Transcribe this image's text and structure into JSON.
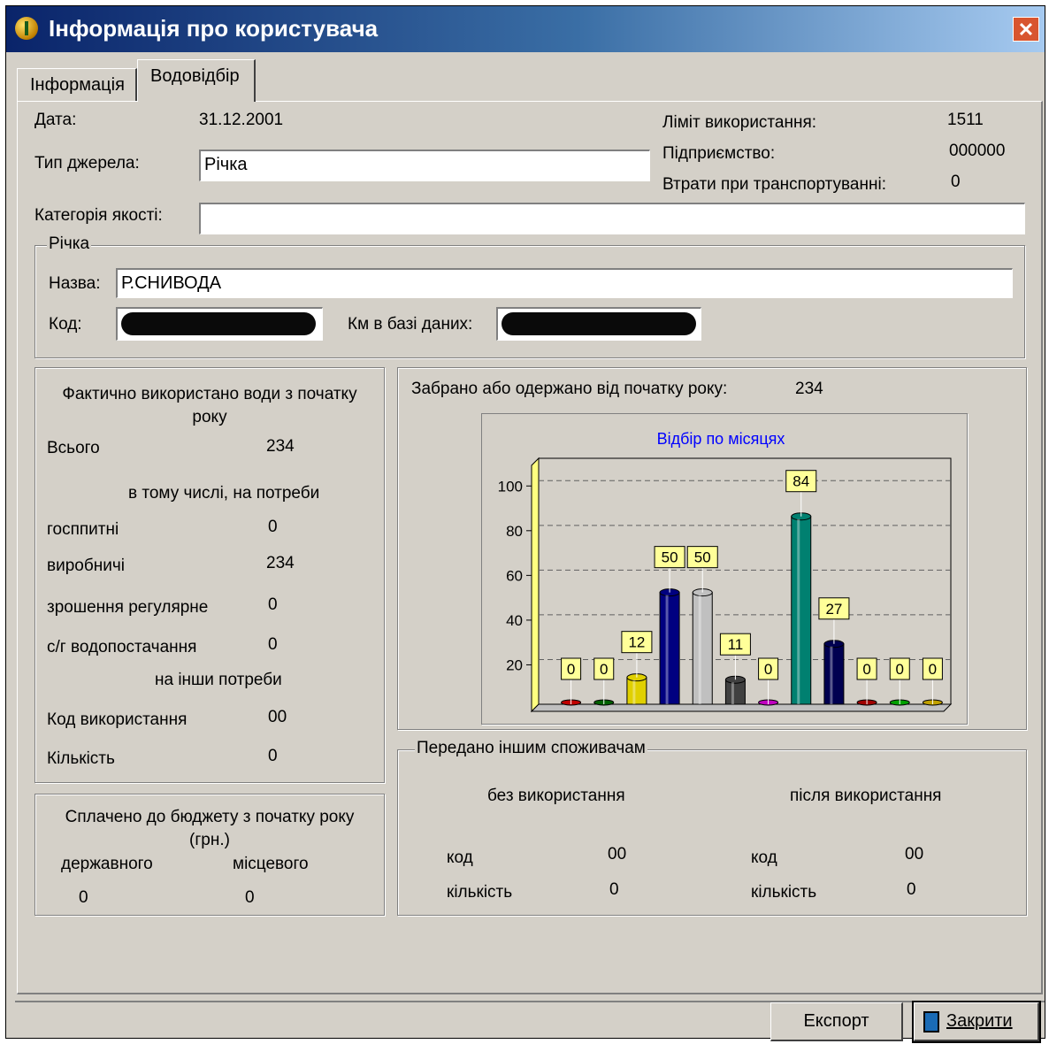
{
  "window": {
    "title": "Інформація про користувача"
  },
  "tabs": [
    {
      "label": "Інформація"
    },
    {
      "label": "Водовідбір"
    }
  ],
  "top": {
    "date_label": "Дата:",
    "date_value": "31.12.2001",
    "source_type_label": "Тип джерела:",
    "source_type_value": "Річка",
    "quality_label": "Категорія якості:",
    "quality_value": "",
    "limit_label": "Ліміт використання:",
    "limit_value": "1511",
    "enterprise_label": "Підприємство:",
    "enterprise_value": "000000",
    "losses_label": "Втрати при транспортуванні:",
    "losses_value": "0"
  },
  "river": {
    "group_title": "Річка",
    "name_label": "Назва:",
    "name_value": "Р.СНИВОДА",
    "code_label": "Код:",
    "km_label": "Км в базі даних:"
  },
  "actual": {
    "title": "Фактично використано води з початку року",
    "total_label": "Всього",
    "total_value": "234",
    "including_label": "в тому числі, на потреби",
    "household_label": "госппитні",
    "household_value": "0",
    "production_label": "виробничі",
    "production_value": "234",
    "irrigation_label": "зрошення регулярне",
    "irrigation_value": "0",
    "agri_label": "с/г водопостачання",
    "agri_value": "0",
    "other_label": "на інши потреби",
    "usage_code_label": "Код використання",
    "usage_code_value": "00",
    "quantity_label": "Кількість",
    "quantity_value": "0"
  },
  "budget": {
    "title": "Сплачено до бюджету з початку року (грн.)",
    "state_label": "державного",
    "state_value": "0",
    "local_label": "місцевого",
    "local_value": "0"
  },
  "withdrawn": {
    "label": "Забрано або одержано від початку року:",
    "value": "234"
  },
  "transferred": {
    "group_title": "Передано іншим споживачам",
    "without_use_label": "без використання",
    "after_use_label": "після використання",
    "code_label": "код",
    "quantity_label": "кількість",
    "without_code": "00",
    "without_qty": "0",
    "after_code": "00",
    "after_qty": "0"
  },
  "buttons": {
    "export": "Експорт",
    "close": "Закрити"
  },
  "chart_data": {
    "type": "bar",
    "title": "Відбір по місяцях",
    "values": [
      0,
      0,
      12,
      50,
      50,
      11,
      0,
      84,
      27,
      0,
      0,
      0
    ],
    "colors": [
      "#c00000",
      "#006000",
      "#e0d000",
      "#000080",
      "#c0c0c0",
      "#404040",
      "#c000c0",
      "#008070",
      "#000050",
      "#a00000",
      "#00a000",
      "#c0a000"
    ],
    "yticks": [
      20,
      40,
      60,
      80,
      100
    ],
    "ylim": [
      0,
      110
    ],
    "grid": true
  }
}
